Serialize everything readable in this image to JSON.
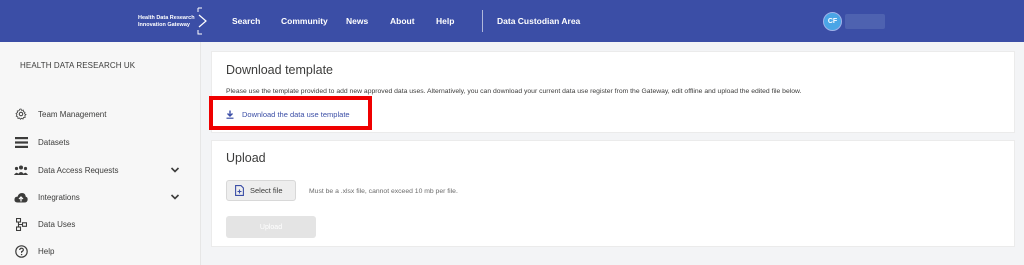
{
  "header": {
    "logo_line1": "Health Data Research",
    "logo_line2": "Innovation Gateway",
    "nav": [
      "Search",
      "Community",
      "News",
      "About",
      "Help"
    ],
    "custodian_area": "Data Custodian Area",
    "avatar_initials": "CF"
  },
  "sidebar": {
    "org": "HEALTH DATA RESEARCH UK",
    "items": [
      {
        "label": "Team Management",
        "icon": "gear-icon"
      },
      {
        "label": "Datasets",
        "icon": "list-icon"
      },
      {
        "label": "Data Access Requests",
        "icon": "group-icon"
      },
      {
        "label": "Integrations",
        "icon": "cloud-upload-icon"
      },
      {
        "label": "Data Uses",
        "icon": "hierarchy-icon"
      },
      {
        "label": "Help",
        "icon": "help-circle-icon"
      }
    ]
  },
  "download": {
    "title": "Download template",
    "description": "Please use the template provided to add new approved data uses. Alternatively, you can download your current data use register from the Gateway, edit offline and upload the edited file below.",
    "link": "Download the data use template"
  },
  "upload": {
    "title": "Upload",
    "select_file": "Select file",
    "hint": "Must be a .xlsx file, cannot exceed 10 mb per file.",
    "upload_button": "Upload"
  },
  "colors": {
    "header_bg": "#3b4ea6",
    "link": "#3b4ea6",
    "highlight": "#ef0000"
  }
}
